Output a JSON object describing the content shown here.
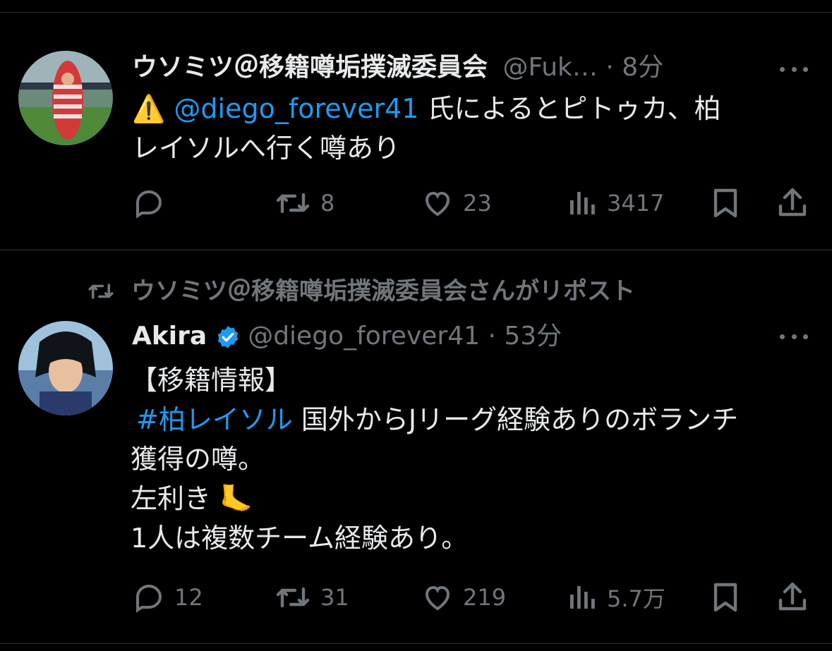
{
  "tweet1": {
    "author_name": "ウソミツ＠移籍噂垢撲滅委員会",
    "handle": "@Fuk…",
    "separator": "·",
    "time": "8分",
    "warning_emoji": "⚠️",
    "mention": "@diego_forever41",
    "text_line1_rest": " 氏によるとピトゥカ、柏",
    "text_line2": "レイソルへ行く噂あり",
    "reply_count": "",
    "repost_count": "8",
    "like_count": "23",
    "view_count": "3417"
  },
  "repost_banner": {
    "text": "ウソミツ＠移籍噂垢撲滅委員会さんがリポスト"
  },
  "tweet2": {
    "author_name": "Akira",
    "handle": "@diego_forever41",
    "separator": "·",
    "time": "53分",
    "line1": "【移籍情報】",
    "hashtag": "#柏レイソル",
    "line2_rest": " 国外からJリーグ経験ありのボランチ",
    "line3": "獲得の噂。",
    "line4": "左利き",
    "foot_emoji": "🦶",
    "line5": "1人は複数チーム経験あり。",
    "reply_count": "12",
    "repost_count": "31",
    "like_count": "219",
    "view_count": "5.7万"
  },
  "colors": {
    "background": "#000000",
    "text": "#e7e9ea",
    "muted": "#71767b",
    "accent": "#1d9bf0",
    "divider": "#2f3336"
  }
}
